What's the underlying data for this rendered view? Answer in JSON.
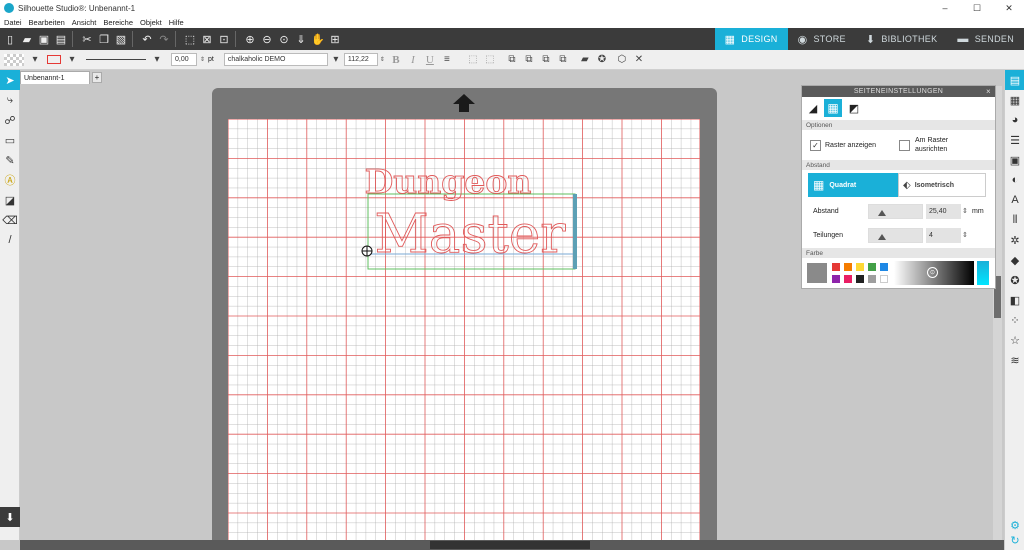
{
  "window": {
    "title": "Silhouette Studio®: Unbenannt-1",
    "minimize": "–",
    "maximize": "☐",
    "close": "✕"
  },
  "menu": [
    "Datei",
    "Bearbeiten",
    "Ansicht",
    "Bereiche",
    "Objekt",
    "Hilfe"
  ],
  "main_tabs": [
    {
      "label": "DESIGN",
      "icon": "grid-icon"
    },
    {
      "label": "STORE",
      "icon": "globe-icon"
    },
    {
      "label": "BIBLIOTHEK",
      "icon": "download-icon"
    },
    {
      "label": "SENDEN",
      "icon": "cutter-icon"
    }
  ],
  "format_bar": {
    "line_width": "0,00",
    "line_unit": "pt",
    "font": "chalkaholic DEMO",
    "font_size": "112,22",
    "bold": "B",
    "italic": "I",
    "underline": "U"
  },
  "document": {
    "tab": "Unbenannt-1",
    "add": "+"
  },
  "canvas": {
    "line1": "Dungeon",
    "line2": "Master",
    "text_color": "#e05a5a"
  },
  "panel": {
    "title": "SEITENEINSTELLUNGEN",
    "close": "×",
    "optionen": {
      "header": "Optionen",
      "show_grid": "Raster anzeigen",
      "snap_grid_l1": "Am Raster",
      "snap_grid_l2": "ausrichten"
    },
    "abstand": {
      "header": "Abstand",
      "quadrat": "Quadrat",
      "isometrisch": "Isometrisch",
      "abstand_label": "Abstand",
      "abstand_value": "25,40",
      "unit": "mm",
      "teilungen_label": "Teilungen",
      "teilungen_value": "4"
    },
    "farbe": {
      "header": "Farbe",
      "swatches": [
        "#e53935",
        "#f57c00",
        "#fdd835",
        "#43a047",
        "#1e88e5",
        "#8e24aa",
        "#e91e63",
        "#212121",
        "#9e9e9e",
        "#ffffff"
      ]
    }
  },
  "colors": {
    "accent": "#1ab0d8",
    "grid_major": "#e05a5a",
    "grid_minor": "#b0b0b0"
  }
}
